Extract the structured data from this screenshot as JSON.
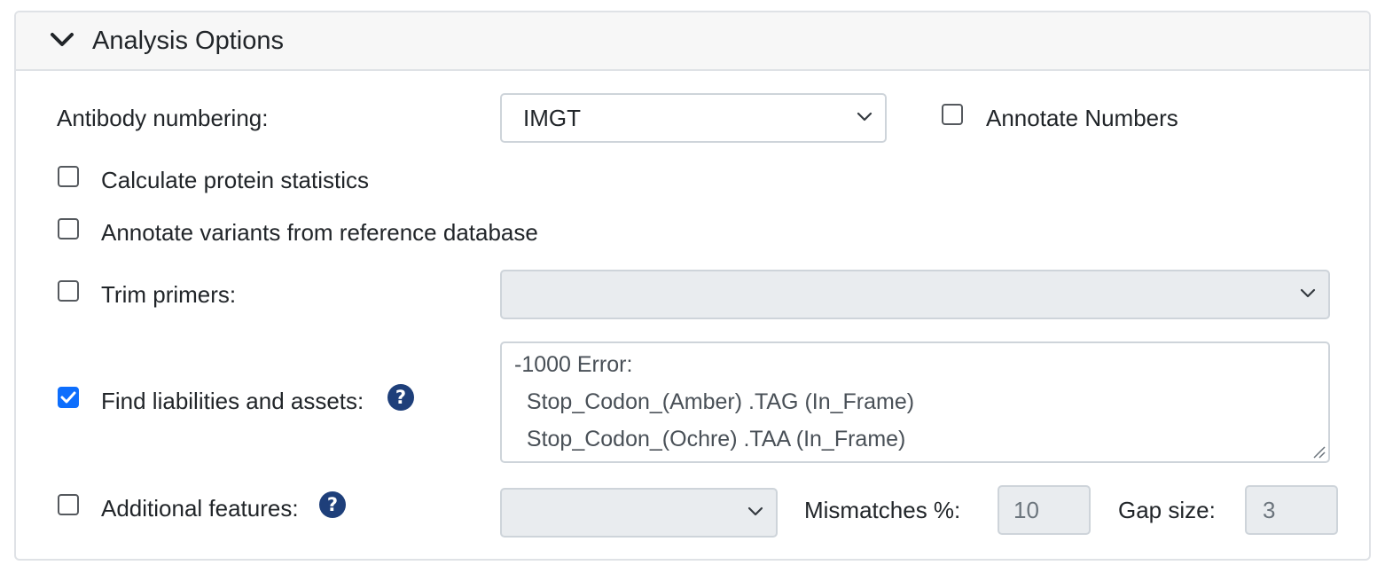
{
  "panel": {
    "title": "Analysis Options",
    "chevron_icon": "chevron-down-icon"
  },
  "antibody_numbering": {
    "label": "Antibody numbering:",
    "selected": "IMGT"
  },
  "annotate_numbers": {
    "label": "Annotate Numbers",
    "checked": false
  },
  "calculate_protein_statistics": {
    "label": "Calculate protein statistics",
    "checked": false
  },
  "annotate_variants": {
    "label": "Annotate variants from reference database",
    "checked": false
  },
  "trim_primers": {
    "label": "Trim primers:",
    "checked": false,
    "selected": ""
  },
  "find_liabilities": {
    "label": "Find liabilities and assets:",
    "checked": true,
    "help_icon": "question-circle-icon",
    "help_glyph": "?",
    "textarea_lines": [
      "-1000 Error:",
      "  Stop_Codon_(Amber) .TAG (In_Frame)",
      "  Stop_Codon_(Ochre) .TAA (In_Frame)"
    ]
  },
  "additional_features": {
    "label": "Additional features:",
    "checked": false,
    "help_icon": "question-circle-icon",
    "help_glyph": "?",
    "selected": "",
    "mismatches_label": "Mismatches %:",
    "mismatches_value": "10",
    "gap_size_label": "Gap size:",
    "gap_size_value": "3"
  },
  "colors": {
    "accent": "#0d6efd",
    "help_badge": "#1e3f7a",
    "disabled_bg": "#e9ecef",
    "border": "#ced4da"
  }
}
